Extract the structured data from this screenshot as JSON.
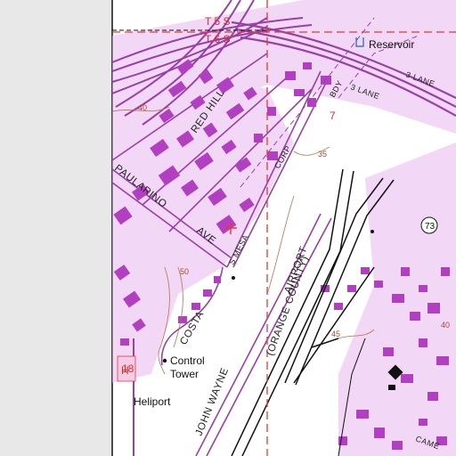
{
  "map": {
    "colors": {
      "background": "#e8e8e8",
      "paper": "#ffffff",
      "urban": "#c95ad4",
      "building": "#b23fc2",
      "road": "#9a3fa8",
      "boundary_red": "#e53935",
      "contour": "#b8734a",
      "black": "#111111"
    },
    "labels": {
      "reservoir": "Reservoir",
      "township_upper": "T 5 S",
      "township_lower": "T 6 S",
      "lane_3_a": "3 LANE",
      "lane_3_b": "3 LANE",
      "red_hill": "RED  HILL",
      "paularino": "PAULARINO",
      "ave": "AVE",
      "corp": "CORP",
      "bdy": "BDY",
      "s_mesa": "S  MESA",
      "costa": "COSTA",
      "airport": "AIRPORT",
      "orange_county": "(ORANGE COUNTY)",
      "john_wayne": "JOHN   WAYNE",
      "control": "Control",
      "tower": "Tower",
      "heliport": "Heliport",
      "came": "CAME",
      "section_7": "7",
      "section_18": "18",
      "route_73": "73",
      "contour_40a": "40",
      "contour_40b": "40",
      "contour_35": "35",
      "contour_45": "45",
      "contour_50": "50",
      "heliport_mark": "H"
    }
  }
}
